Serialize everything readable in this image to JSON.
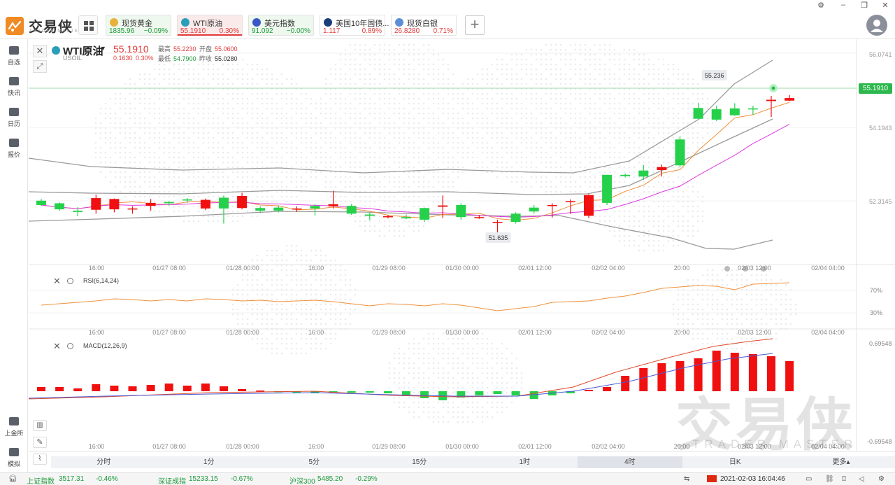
{
  "brand": {
    "name": "交易侠",
    "sub": "TRADER MASTER"
  },
  "quotes": [
    {
      "name": "现货黄金",
      "price": "1835.96",
      "change": "−0.09%",
      "color": "#1e9a3a",
      "icon_color": "#e8b23a",
      "icon": "gold-coin-icon",
      "bg": "#eef8ee"
    },
    {
      "name": "WTI原油",
      "price": "55.1910",
      "change": "0.30%",
      "color": "#e23b3b",
      "icon_color": "#2a9db8",
      "icon": "oil-drop-icon",
      "bg": "#fbeaea"
    },
    {
      "name": "美元指数",
      "price": "91.092",
      "change": "−0.00%",
      "color": "#1e9a3a",
      "icon_color": "#3a58c7",
      "icon": "us-flag-icon",
      "bg": "#eef8ee"
    },
    {
      "name": "美国10年国债...",
      "price": "1.117",
      "change": "0.89%",
      "color": "#e23b3b",
      "icon_color": "#1a3e7a",
      "icon": "bond-chart-icon",
      "bg": "#ffffff"
    },
    {
      "name": "现货白银",
      "price": "26.8280",
      "change": "0.71%",
      "color": "#e23b3b",
      "icon_color": "#5b8fd6",
      "icon": "silver-coin-icon",
      "bg": "#ffffff"
    }
  ],
  "sidebar": [
    {
      "label": "自选",
      "icon": "bookmark-icon"
    },
    {
      "label": "快讯",
      "icon": "news-icon"
    },
    {
      "label": "日历",
      "icon": "calendar-icon"
    },
    {
      "label": "报价",
      "icon": "trend-icon"
    },
    {
      "label": "上金所",
      "icon": "exchange-icon"
    },
    {
      "label": "模拟",
      "icon": "wallet-icon"
    }
  ],
  "symbol": {
    "name": "WTI原油",
    "code": "USOIL",
    "price": "55.1910",
    "change": "0.1630",
    "pct": "0.30%",
    "high_label": "最高",
    "high": "55.2230",
    "open_label": "开盘",
    "open": "55.0600",
    "low_label": "最低",
    "low": "54.7900",
    "prev_label": "昨收",
    "prev": "55.0280"
  },
  "price_tag": "55.1910",
  "annotations": {
    "high": "55.236",
    "low": "51.635"
  },
  "price_axis": [
    "56.0741",
    "54.1943",
    "52.3145"
  ],
  "rsi": {
    "label": "RSI(6,14,24)",
    "levels": [
      "70%",
      "30%"
    ]
  },
  "macd": {
    "label": "MACD(12,26,9)",
    "levels": [
      "0.69548",
      "-0.69548"
    ]
  },
  "time_axis": [
    "16:00",
    "01/27 08:00",
    "01/28 00:00",
    "16:00",
    "01/29 08:00",
    "01/30 00:00",
    "02/01 12:00",
    "02/02 04:00",
    "20:00",
    "02/03 12:00",
    "02/04 04:00"
  ],
  "timeframes": [
    "分时",
    "1分",
    "5分",
    "15分",
    "1时",
    "4时",
    "日K"
  ],
  "timeframe_active": "4时",
  "more_label": "更多▴",
  "status": [
    {
      "name": "上证指数",
      "value": "3517.31",
      "change": "-0.46%"
    },
    {
      "name": "深证成指",
      "value": "15233.15",
      "change": "-0.67%"
    },
    {
      "name": "沪深300",
      "value": "5485.20",
      "change": "-0.29%"
    }
  ],
  "datetime": "2021-02-03 16:04:46",
  "watermark": {
    "big": "交易侠",
    "small": "TRADER MASTER"
  },
  "chart_data": {
    "type": "candlestick",
    "ylim": [
      51.3,
      56.2
    ],
    "candles": [
      [
        52.78,
        52.82,
        52.66,
        52.68
      ],
      [
        52.72,
        52.74,
        52.55,
        52.58
      ],
      [
        52.55,
        52.63,
        52.42,
        52.52
      ],
      [
        52.57,
        52.92,
        52.48,
        52.84
      ],
      [
        52.58,
        52.83,
        52.51,
        52.82
      ],
      [
        52.6,
        52.65,
        52.48,
        52.6
      ],
      [
        52.66,
        52.82,
        52.55,
        52.73
      ],
      [
        52.75,
        52.77,
        52.67,
        52.72
      ],
      [
        52.81,
        52.84,
        52.73,
        52.8
      ],
      [
        52.6,
        52.83,
        52.56,
        52.8
      ],
      [
        52.85,
        52.9,
        52.25,
        52.6
      ],
      [
        52.61,
        52.96,
        52.58,
        52.89
      ],
      [
        52.61,
        52.65,
        52.51,
        52.55
      ],
      [
        52.62,
        52.67,
        52.51,
        52.55
      ],
      [
        52.6,
        52.65,
        52.52,
        52.6
      ],
      [
        52.66,
        52.7,
        52.44,
        52.6
      ],
      [
        52.65,
        53.01,
        52.6,
        52.7
      ],
      [
        52.66,
        52.7,
        52.45,
        52.48
      ],
      [
        52.46,
        52.5,
        52.33,
        52.43
      ],
      [
        52.42,
        52.45,
        52.37,
        52.42
      ],
      [
        52.4,
        52.46,
        52.35,
        52.37
      ],
      [
        52.61,
        52.62,
        52.29,
        52.34
      ],
      [
        52.64,
        52.9,
        52.38,
        52.67
      ],
      [
        52.68,
        52.72,
        52.34,
        52.4
      ],
      [
        52.4,
        52.45,
        52.36,
        52.4
      ],
      [
        52.27,
        52.34,
        52.04,
        52.29
      ],
      [
        52.48,
        52.51,
        52.25,
        52.29
      ],
      [
        52.62,
        52.68,
        52.48,
        52.53
      ],
      [
        52.68,
        52.72,
        52.39,
        52.68
      ],
      [
        52.77,
        52.81,
        52.47,
        52.77
      ],
      [
        52.43,
        52.93,
        52.38,
        52.91
      ],
      [
        53.38,
        53.38,
        52.68,
        52.73
      ],
      [
        53.38,
        53.41,
        53.32,
        53.35
      ],
      [
        53.48,
        53.61,
        53.26,
        53.34
      ],
      [
        53.49,
        53.62,
        53.34,
        53.56
      ],
      [
        54.2,
        54.27,
        53.55,
        53.6
      ],
      [
        54.93,
        55.05,
        54.7,
        54.68
      ],
      [
        54.9,
        54.98,
        54.63,
        54.66
      ],
      [
        54.92,
        55.04,
        54.75,
        54.76
      ],
      [
        54.92,
        54.98,
        54.77,
        54.9
      ],
      [
        55.09,
        55.21,
        54.72,
        55.12
      ],
      [
        55.1,
        55.23,
        55.09,
        55.16
      ]
    ]
  }
}
